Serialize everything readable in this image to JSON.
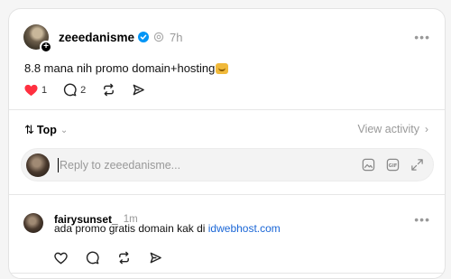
{
  "post": {
    "username": "zeeedanisme",
    "time": "7h",
    "text": "8.8 mana nih promo domain+hosting",
    "emoji_icon": "grinning-cat-emoji",
    "like_count": "1",
    "reply_count": "2",
    "more": "•••"
  },
  "sort": {
    "label": "Top",
    "view_activity": "View activity"
  },
  "reply": {
    "placeholder": "Reply to zeeedanisme...",
    "gif_label": "GIF"
  },
  "comment": {
    "username": "fairysunset_",
    "time": "1m",
    "text_prefix": "ada promo gratis domain kak di ",
    "link": "idwebhost.com",
    "more": "•••"
  },
  "colors": {
    "like_red": "#ff3040",
    "link_blue": "#1a66d6",
    "verified_blue": "#0095f6",
    "muted_gray": "#999999"
  }
}
